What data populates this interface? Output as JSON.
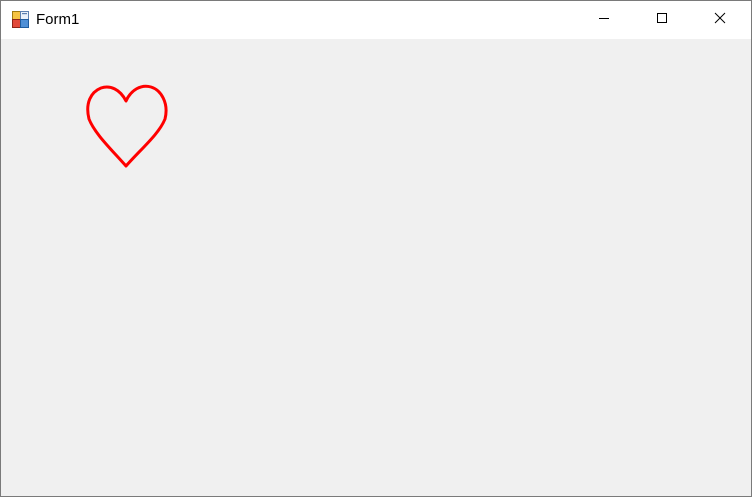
{
  "window": {
    "title": "Form1",
    "icon": "winforms-app-icon"
  },
  "caption_buttons": {
    "minimize": "minimize-icon",
    "maximize": "maximize-icon",
    "close": "close-icon"
  },
  "client_area": {
    "background": "#F0F0F0",
    "drawing": {
      "shape": "heart-outline",
      "stroke_color": "#FF0000"
    }
  }
}
